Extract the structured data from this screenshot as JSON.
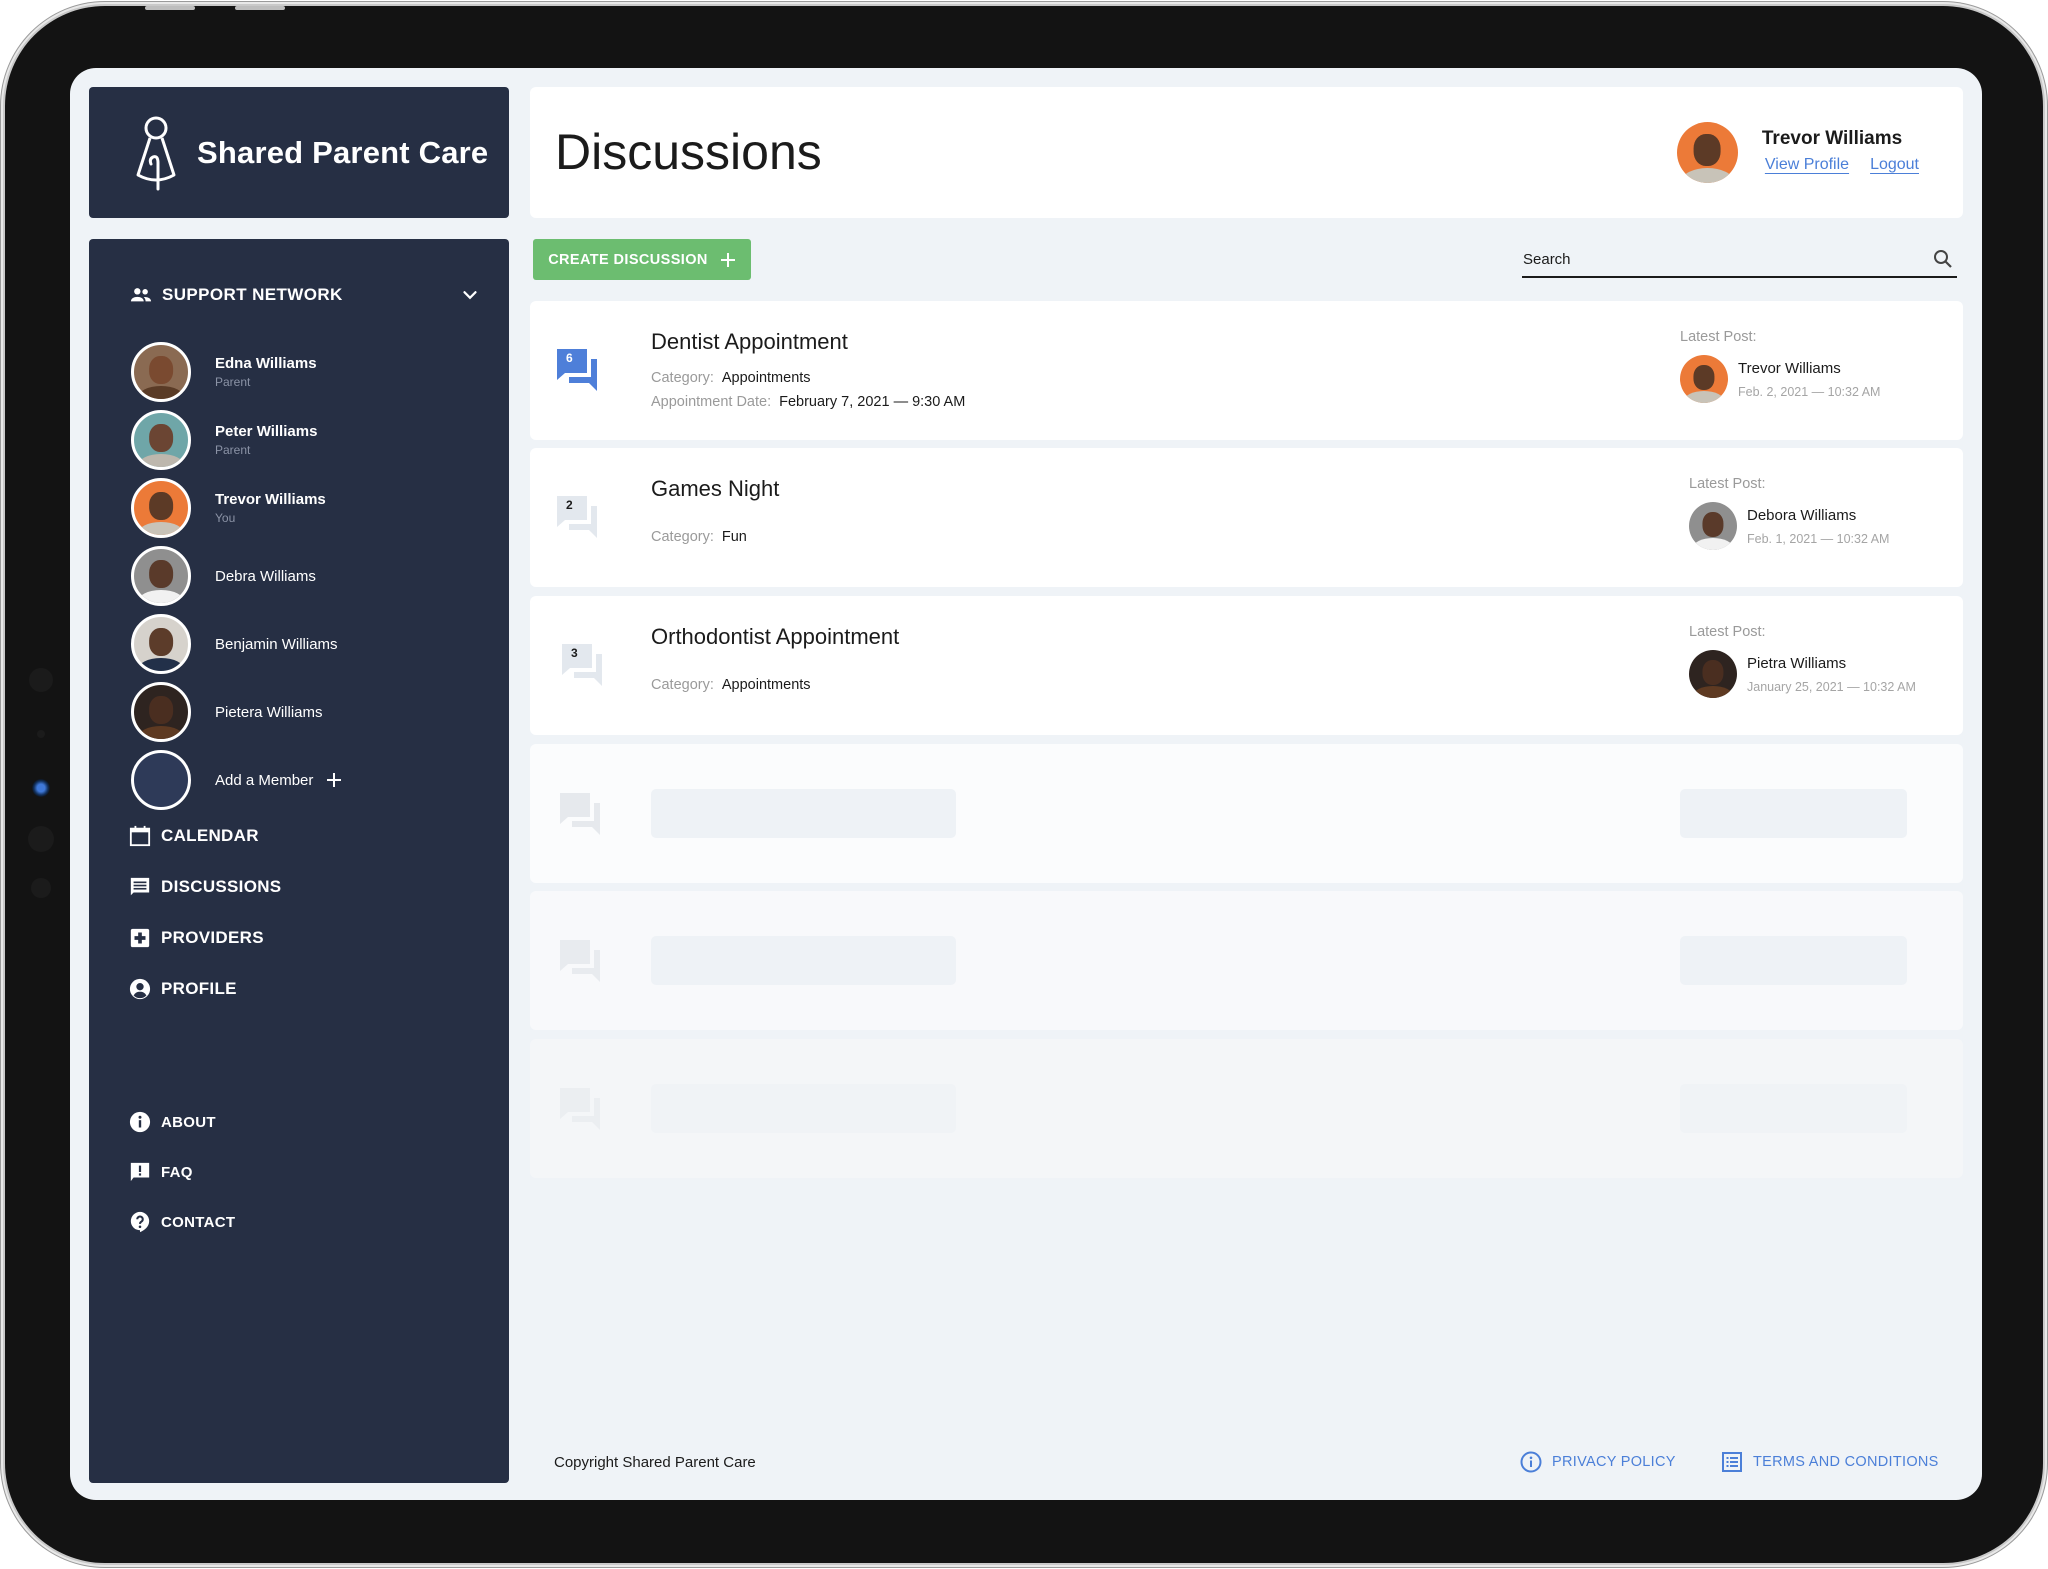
{
  "app": {
    "name": "Shared Parent Care"
  },
  "sidebar": {
    "support_network": {
      "label": "SUPPORT NETWORK",
      "members": [
        {
          "name": "Edna Williams",
          "role": "Parent",
          "skin": "#7a4a30",
          "bg": "#8a6a52",
          "shirt": "#5a3b26"
        },
        {
          "name": "Peter Williams",
          "role": "Parent",
          "skin": "#6b4533",
          "bg": "#6fa6a8",
          "shirt": "#bdb7ad"
        },
        {
          "name": "Trevor Williams",
          "role": "You",
          "skin": "#5c3a26",
          "bg": "#ec7a38",
          "shirt": "#c8c3b8"
        },
        {
          "name": "Debra Williams",
          "role": "",
          "skin": "#5a3a2a",
          "bg": "#8f8f8f",
          "shirt": "#f1f1f1"
        },
        {
          "name": "Benjamin Williams",
          "role": "",
          "skin": "#5c3c2a",
          "bg": "#d6d2cc",
          "shirt": "#223049"
        },
        {
          "name": "Pietera Williams",
          "role": "",
          "skin": "#4a2e20",
          "bg": "#2e2420",
          "shirt": "#5e3a22"
        }
      ],
      "add_member_label": "Add a Member"
    },
    "nav": [
      {
        "label": "CALENDAR",
        "icon": "calendar-icon"
      },
      {
        "label": "DISCUSSIONS",
        "icon": "discussions-icon"
      },
      {
        "label": "PROVIDERS",
        "icon": "medical-plus-icon"
      },
      {
        "label": "PROFILE",
        "icon": "account-circle-icon"
      }
    ],
    "secondary_nav": [
      {
        "label": "ABOUT",
        "icon": "info-icon"
      },
      {
        "label": "FAQ",
        "icon": "feedback-icon"
      },
      {
        "label": "CONTACT",
        "icon": "help-icon"
      }
    ]
  },
  "header": {
    "title": "Discussions",
    "user": {
      "name": "Trevor Williams",
      "view_profile": "View Profile",
      "logout": "Logout"
    }
  },
  "toolbar": {
    "create_label": "CREATE DISCUSSION",
    "search_placeholder": "Search",
    "search_value": ""
  },
  "discussions": [
    {
      "count": "6",
      "unread": true,
      "title": "Dentist Appointment",
      "category_label": "Category:",
      "category": "Appointments",
      "date_label": "Appointment Date:",
      "date": "February 7, 2021 — 9:30 AM",
      "latest_label": "Latest Post:",
      "latest_author": "Trevor Williams",
      "latest_date": "Feb. 2, 2021 — 10:32 AM"
    },
    {
      "count": "2",
      "unread": false,
      "title": "Games Night",
      "category_label": "Category:",
      "category": "Fun",
      "latest_label": "Latest Post:",
      "latest_author": "Debora Williams",
      "latest_date": "Feb. 1, 2021 — 10:32 AM"
    },
    {
      "count": "3",
      "unread": false,
      "title": "Orthodontist Appointment",
      "category_label": "Category:",
      "category": "Appointments",
      "latest_label": "Latest Post:",
      "latest_author": "Pietra Williams",
      "latest_date": "January 25, 2021 — 10:32 AM"
    }
  ],
  "footer": {
    "copyright": "Copyright Shared Parent Care",
    "privacy": "PRIVACY POLICY",
    "terms": "TERMS AND CONDITIONS"
  },
  "colors": {
    "sidebar_bg": "#262f44",
    "accent_green": "#6cbd70",
    "link_blue": "#4b7fd8",
    "unread_icon": "#4e7fd9",
    "read_icon": "#e3e8ee"
  }
}
